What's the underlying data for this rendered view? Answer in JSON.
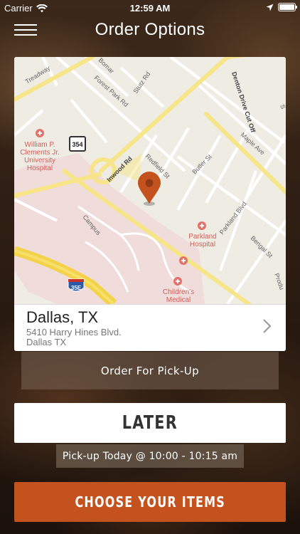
{
  "status_bar": {
    "carrier": "Carrier",
    "time": "12:59 AM",
    "battery_level": 1.0
  },
  "nav": {
    "title": "Order Options",
    "menu_icon": "hamburger-menu-icon"
  },
  "map": {
    "labels": {
      "treadway": "Treadway",
      "bomar": "Bomar",
      "forest_park": "Forest Park Rd",
      "stutz": "Stutz Rd",
      "denton": "Denton Drive Cut Off",
      "maple": "Maple Ave",
      "hospital1_line1": "William P.",
      "hospital1_line2": "Clements Jr.",
      "hospital1_line3": "University",
      "hospital1_line4": "Hospital",
      "route354": "354",
      "inwood": "Inwood Rd",
      "redfield": "Redfield St",
      "butler": "Butler St",
      "campus": "Campus",
      "parkland_line1": "Parkland",
      "parkland_line2": "Hospital",
      "parkland_blvd": "Parkland Blvd",
      "bengal": "Bengal St",
      "route35e": "35E",
      "childrens_line1": "Children's",
      "childrens_line2": "Medical",
      "prod": "Produ",
      "s_edge": "S"
    },
    "accent_pin": "#c4521f"
  },
  "location": {
    "city": "Dallas, TX",
    "street": "5410 Harry Hines Blvd.",
    "city_short": "Dallas TX"
  },
  "order_type": "Order For Pick-Up",
  "timing_button": "LATER",
  "pickup_time": "Pick-up Today @ 10:00 - 10:15 am",
  "cta": "CHOOSE YOUR ITEMS",
  "colors": {
    "cta": "#c4521f",
    "map_road": "#f7e58a",
    "map_campus": "#f1dcdc"
  }
}
